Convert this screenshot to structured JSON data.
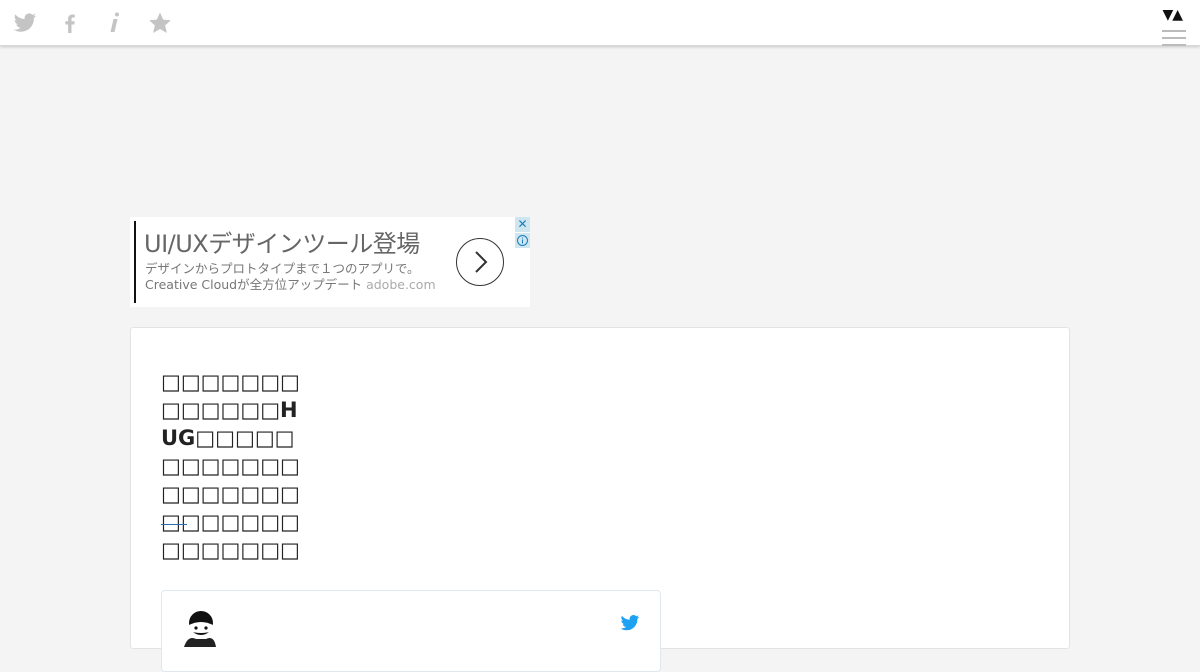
{
  "topbar": {
    "icons": [
      "twitter-icon",
      "facebook-icon",
      "info-icon",
      "star-icon"
    ],
    "sort_toggle": "▼▲"
  },
  "ad": {
    "headline": "UI/UXデザインツール登場",
    "description": "デザインからプロトタイプまで１つのアプリで。",
    "line2": "Creative Cloudが全方位アップデート",
    "domain": "adobe.com",
    "close_glyph": "✕"
  },
  "card": {
    "title": "□□□□□□□□□□□□□HUG□□□□□□□□□□□□□□□□□□□□□□□□□□□□□□□□□",
    "accent_color": "#2a6db0"
  },
  "colors": {
    "background": "#f4f4f4",
    "twitter_blue": "#1da1f2",
    "icon_gray": "#c4c4c4"
  }
}
